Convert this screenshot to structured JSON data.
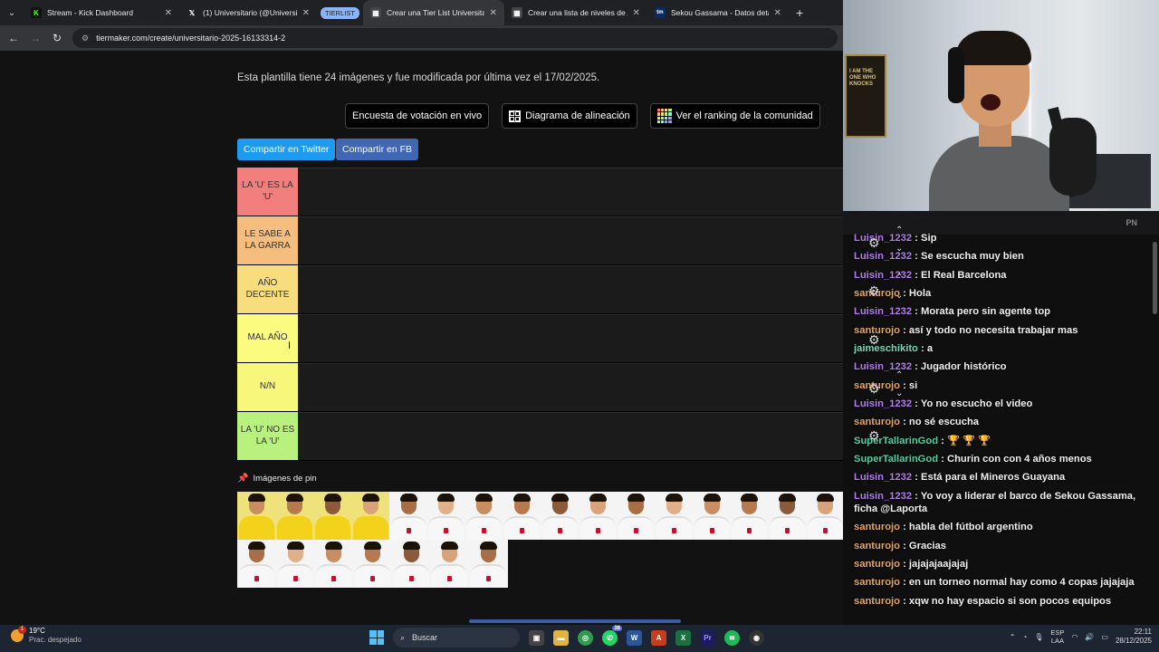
{
  "browser": {
    "tabs": [
      {
        "title": "Stream - Kick Dashboard",
        "favicon": "kick-icon",
        "active": false
      },
      {
        "title": "(1) Universitario (@Universitario",
        "favicon": "x-icon",
        "active": false
      },
      {
        "title": "Crear una Tier List Universitario",
        "favicon": "tiermaker-icon",
        "active": true
      },
      {
        "title": "Crear una lista de niveles de Al",
        "favicon": "tiermaker-icon",
        "active": false
      },
      {
        "title": "Sekou Gassama - Datos detalla",
        "favicon": "transfermarkt-icon",
        "active": false
      }
    ],
    "tab_group_label": "TIERLIST",
    "url": "tiermaker.com/create/universitario-2025-16133314-2"
  },
  "page": {
    "description": "Esta plantilla tiene 24 imágenes y fue modificada por última vez el 17/02/2025.",
    "buttons": {
      "vote": "Encuesta de votación en vivo",
      "alignment": "Diagrama de alineación",
      "community": "Ver el ranking de la comunidad"
    },
    "share": {
      "twitter": "Compartir en Twitter",
      "facebook": "Compartir en FB"
    },
    "tiers": [
      {
        "label": "LA 'U' ES LA 'U'",
        "color": "#f37e7e"
      },
      {
        "label": "LE SABE A LA GARRA",
        "color": "#f5be7f"
      },
      {
        "label": "AÑO DECENTE",
        "color": "#f7dd7e"
      },
      {
        "label": "MAL AÑO",
        "color": "#fbfb7f"
      },
      {
        "label": "N/N",
        "color": "#f7f77c"
      },
      {
        "label": "LA 'U' NO ES LA 'U'",
        "color": "#b9f17e"
      }
    ],
    "pinned_label": "Imágenes de pin",
    "image_count": 24
  },
  "chat": {
    "header_badge": "PN",
    "messages": [
      {
        "user": "Luisin_1232",
        "color": "purple",
        "text": "Sip"
      },
      {
        "user": "Luisin_1232",
        "color": "purple",
        "text": "Se escucha muy bien"
      },
      {
        "user": "Luisin_1232",
        "color": "purple",
        "text": "El Real Barcelona"
      },
      {
        "user": "santurojo",
        "color": "tan",
        "text": "Hola"
      },
      {
        "user": "Luisin_1232",
        "color": "purple",
        "text": "Morata pero sin agente top"
      },
      {
        "user": "santurojo",
        "color": "tan",
        "text": "así y todo no necesita trabajar mas"
      },
      {
        "user": "jaimeschikito",
        "color": "mint",
        "text": "a"
      },
      {
        "user": "Luisin_1232",
        "color": "purple",
        "text": "Jugador histórico"
      },
      {
        "user": "santurojo",
        "color": "tan",
        "text": "si"
      },
      {
        "user": "Luisin_1232",
        "color": "purple",
        "text": "Yo no escucho el video"
      },
      {
        "user": "santurojo",
        "color": "tan",
        "text": "no sé escucha"
      },
      {
        "user": "SuperTallarinGod",
        "color": "green",
        "text": "🏆 🏆 🏆"
      },
      {
        "user": "SuperTallarinGod",
        "color": "green",
        "text": "Churin con con 4 años menos"
      },
      {
        "user": "Luisin_1232",
        "color": "purple",
        "text": "Está para el Mineros Guayana"
      },
      {
        "user": "Luisin_1232",
        "color": "purple",
        "text": "Yo voy a liderar el barco de Sekou Gassama, ficha @Laporta"
      },
      {
        "user": "santurojo",
        "color": "tan",
        "text": "habla del fútbol argentino"
      },
      {
        "user": "santurojo",
        "color": "tan",
        "text": "Gracias"
      },
      {
        "user": "santurojo",
        "color": "tan",
        "text": "jajajajaajajaj"
      },
      {
        "user": "santurojo",
        "color": "tan",
        "text": "en un torneo normal hay como 4 copas jajajaja"
      },
      {
        "user": "santurojo",
        "color": "tan",
        "text": "xqw no hay espacio si son pocos equipos"
      }
    ],
    "name_colors": {
      "purple": "#b57cf0",
      "tan": "#e3a663",
      "mint": "#79d6b8",
      "green": "#4fd1a0"
    }
  },
  "webcam": {
    "poster_text": "I AM THE ONE WHO KNOCKS"
  },
  "taskbar": {
    "weather_temp": "19°C",
    "weather_desc": "Prac. despejado",
    "weather_badge": "1",
    "search_placeholder": "Buscar",
    "notification_count": "38",
    "lang_top": "ESP",
    "lang_bottom": "LAA",
    "time": "22:11",
    "date": "28/12/2025"
  }
}
